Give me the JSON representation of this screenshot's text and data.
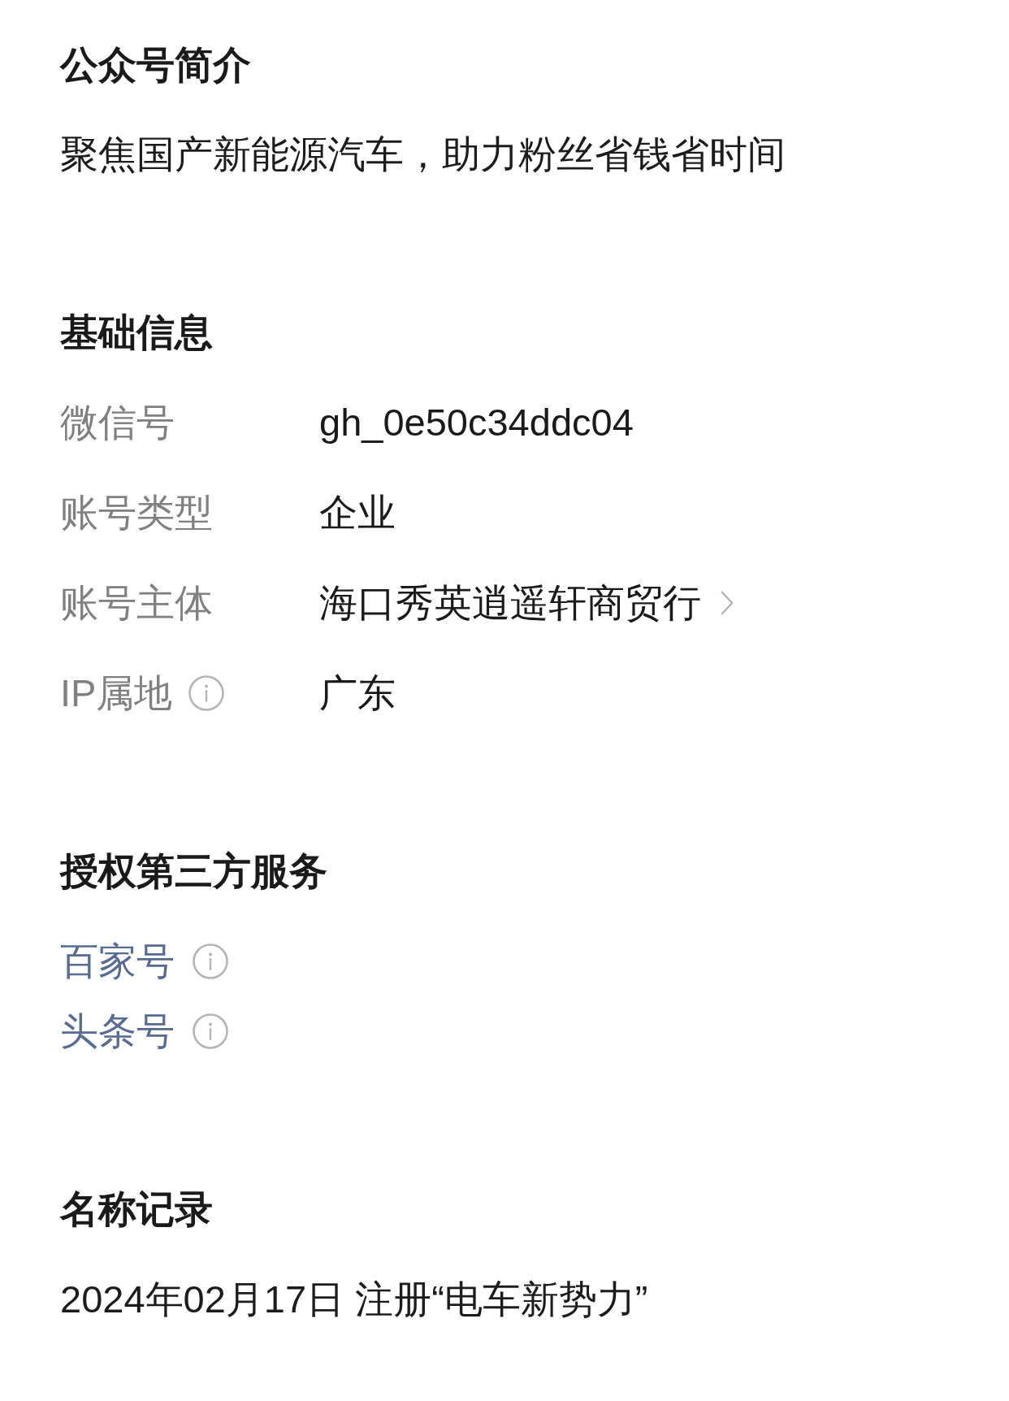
{
  "intro": {
    "heading": "公众号简介",
    "text": "聚焦国产新能源汽车，助力粉丝省钱省时间"
  },
  "basic_info": {
    "heading": "基础信息",
    "rows": [
      {
        "label": "微信号",
        "value": "gh_0e50c34ddc04",
        "kind": "plain"
      },
      {
        "label": "账号类型",
        "value": "企业",
        "kind": "plain"
      },
      {
        "label": "账号主体",
        "value": "海口秀英逍遥轩商贸行",
        "kind": "link"
      },
      {
        "label": "IP属地",
        "value": "广东",
        "kind": "info"
      }
    ]
  },
  "third_party": {
    "heading": "授权第三方服务",
    "services": [
      "百家号",
      "头条号"
    ]
  },
  "name_history": {
    "heading": "名称记录",
    "records": [
      "2024年02月17日 注册“电车新势力”"
    ]
  }
}
